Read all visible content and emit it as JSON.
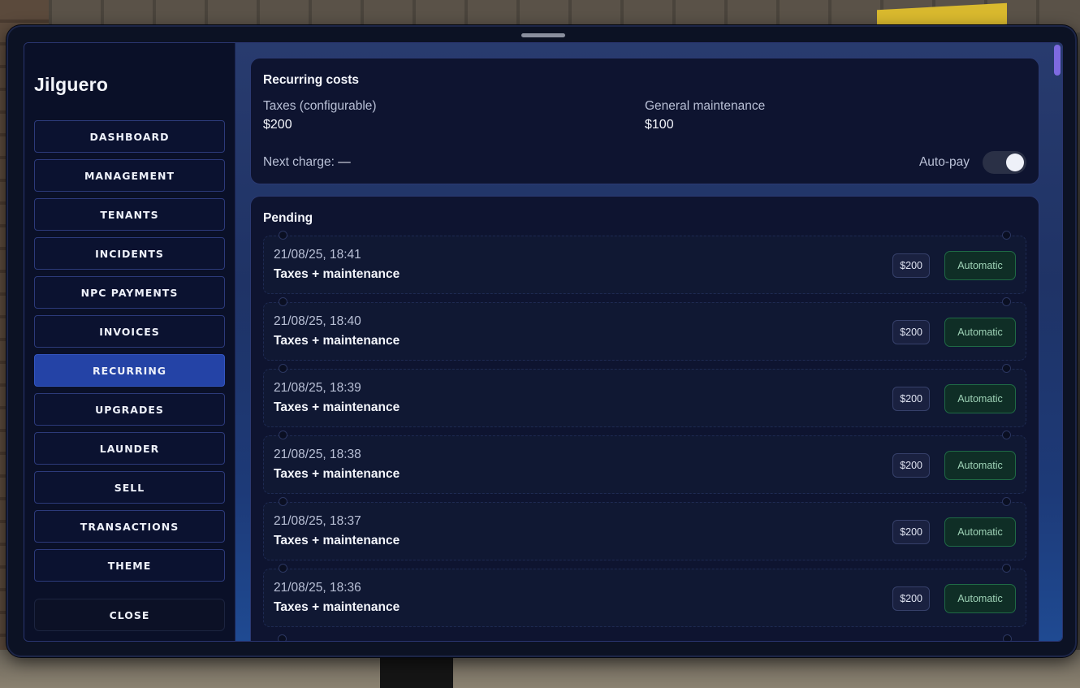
{
  "app": {
    "title": "Jilguero"
  },
  "sidebar": {
    "items": [
      {
        "label": "DASHBOARD",
        "active": false
      },
      {
        "label": "MANAGEMENT",
        "active": false
      },
      {
        "label": "TENANTS",
        "active": false
      },
      {
        "label": "INCIDENTS",
        "active": false
      },
      {
        "label": "NPC PAYMENTS",
        "active": false
      },
      {
        "label": "INVOICES",
        "active": false
      },
      {
        "label": "RECURRING",
        "active": true
      },
      {
        "label": "UPGRADES",
        "active": false
      },
      {
        "label": "LAUNDER",
        "active": false
      },
      {
        "label": "SELL",
        "active": false
      },
      {
        "label": "TRANSACTIONS",
        "active": false
      },
      {
        "label": "THEME",
        "active": false
      }
    ],
    "close_label": "CLOSE"
  },
  "recurring_costs": {
    "title": "Recurring costs",
    "taxes_label": "Taxes (configurable)",
    "taxes_value": "$200",
    "maintenance_label": "General maintenance",
    "maintenance_value": "$100",
    "next_charge_label": "Next charge:",
    "next_charge_value": "—",
    "autopay_label": "Auto-pay",
    "autopay_on": true
  },
  "pending": {
    "title": "Pending",
    "items": [
      {
        "date": "21/08/25, 18:41",
        "desc": "Taxes + maintenance",
        "amount": "$200",
        "status": "Automatic"
      },
      {
        "date": "21/08/25, 18:40",
        "desc": "Taxes + maintenance",
        "amount": "$200",
        "status": "Automatic"
      },
      {
        "date": "21/08/25, 18:39",
        "desc": "Taxes + maintenance",
        "amount": "$200",
        "status": "Automatic"
      },
      {
        "date": "21/08/25, 18:38",
        "desc": "Taxes + maintenance",
        "amount": "$200",
        "status": "Automatic"
      },
      {
        "date": "21/08/25, 18:37",
        "desc": "Taxes + maintenance",
        "amount": "$200",
        "status": "Automatic"
      },
      {
        "date": "21/08/25, 18:36",
        "desc": "Taxes + maintenance",
        "amount": "$200",
        "status": "Automatic"
      }
    ]
  },
  "colors": {
    "accent": "#2443a6",
    "automatic_badge": "#0f2e26",
    "scroll_thumb": "#7e6ae0"
  }
}
